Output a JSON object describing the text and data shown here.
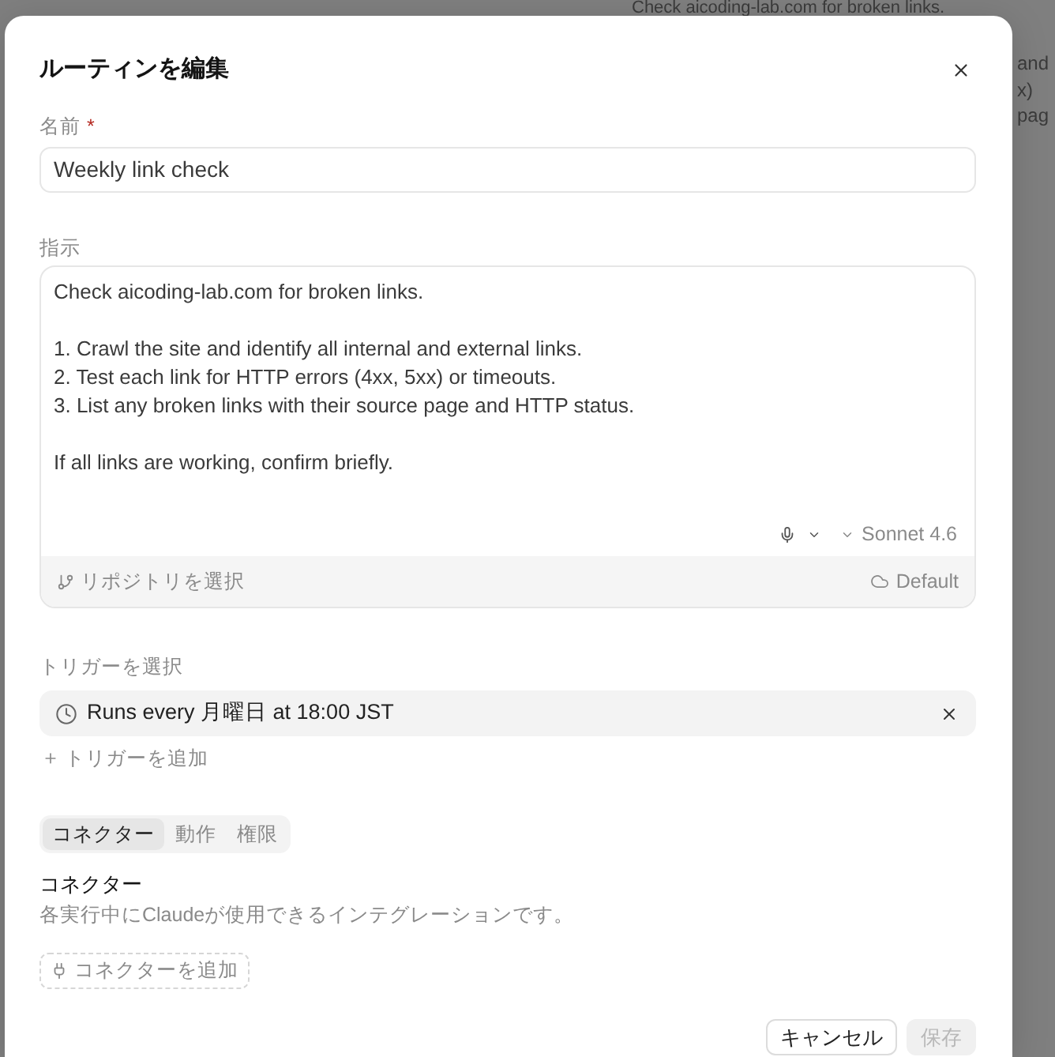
{
  "backdrop": {
    "header_text": "Check aicoding-lab.com for broken links.",
    "side_fragments": [
      "and",
      "x)",
      "pag"
    ]
  },
  "dialog": {
    "title": "ルーティンを編集"
  },
  "name_field": {
    "label": "名前",
    "required_mark": "*",
    "value": "Weekly link check"
  },
  "instructions_field": {
    "label": "指示",
    "value": "Check aicoding-lab.com for broken links.\n\n1. Crawl the site and identify all internal and external links.\n2. Test each link for HTTP errors (4xx, 5xx) or timeouts.\n3. List any broken links with their source page and HTTP status.\n\nIf all links are working, confirm briefly.",
    "model": "Sonnet 4.6",
    "repository_placeholder": "リポジトリを選択",
    "environment": "Default"
  },
  "trigger": {
    "label": "トリガーを選択",
    "items": [
      {
        "text": "Runs every 月曜日 at 18:00 JST"
      }
    ],
    "add_label": "トリガーを追加"
  },
  "tabs": [
    {
      "label": "コネクター",
      "selected": true
    },
    {
      "label": "動作",
      "selected": false
    },
    {
      "label": "権限",
      "selected": false
    }
  ],
  "connectors": {
    "heading": "コネクター",
    "description": "各実行中にClaudeが使用できるインテグレーションです。",
    "add_button": "コネクターを追加"
  },
  "buttons": [
    {
      "label": "キャンセル",
      "disabled": false
    },
    {
      "label": "保存",
      "disabled": true
    }
  ]
}
